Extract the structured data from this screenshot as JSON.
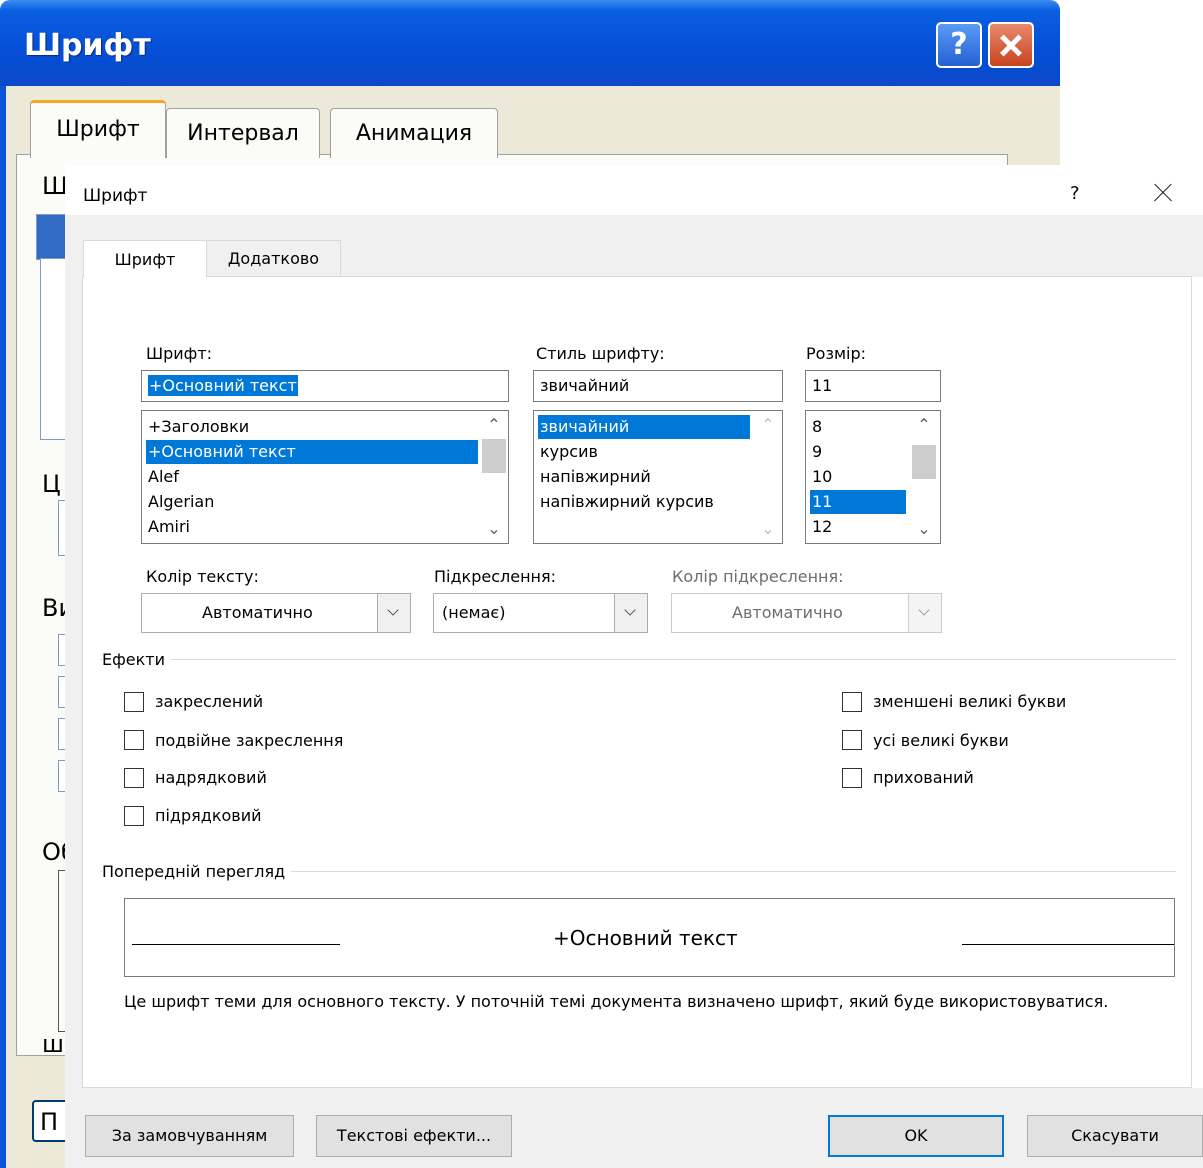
{
  "back_dialog": {
    "title": "Шрифт",
    "help_label": "?",
    "tabs": [
      "Шрифт",
      "Интервал",
      "Анимация"
    ],
    "partial_labels": [
      "Ш",
      "Ц",
      "Ви",
      "Об",
      "ш",
      "П"
    ]
  },
  "dialog": {
    "title": "Шрифт",
    "help_label": "?",
    "tabs": [
      {
        "label": "Шрифт",
        "active": true
      },
      {
        "label": "Додатково",
        "active": false
      }
    ],
    "font": {
      "label": "Шрифт:",
      "value": "+Основний текст",
      "items": [
        "+Заголовки",
        "+Основний текст",
        "Alef",
        "Algerian",
        "Amiri"
      ],
      "selected_index": 1
    },
    "style": {
      "label": "Стиль шрифту:",
      "value": "звичайний",
      "items": [
        "звичайний",
        "курсив",
        "напівжирний",
        "напівжирний курсив"
      ],
      "selected_index": 0
    },
    "size": {
      "label": "Розмір:",
      "value": "11",
      "items": [
        "8",
        "9",
        "10",
        "11",
        "12"
      ],
      "selected_index": 3
    },
    "text_color": {
      "label": "Колір тексту:",
      "value": "Автоматично"
    },
    "underline": {
      "label": "Підкреслення:",
      "value": "(немає)"
    },
    "underline_color": {
      "label": "Колір підкреслення:",
      "value": "Автоматично",
      "disabled": true
    },
    "effects": {
      "title": "Ефекти",
      "left": [
        {
          "label": "закреслений",
          "checked": false
        },
        {
          "label": "подвійне закреслення",
          "checked": false
        },
        {
          "label": "надрядковий",
          "checked": false
        },
        {
          "label": "підрядковий",
          "checked": false
        }
      ],
      "right": [
        {
          "label": "зменшені великі букви",
          "checked": false
        },
        {
          "label": "усі великі букви",
          "checked": false
        },
        {
          "label": "прихований",
          "checked": false
        }
      ]
    },
    "preview": {
      "title": "Попередній перегляд",
      "sample": "+Основний текст",
      "description": "Це шрифт теми для основного тексту. У поточній темі документа визначено шрифт, який буде використовуватися."
    },
    "buttons": {
      "default": "За замовчуванням",
      "text_effects": "Текстові ефекти...",
      "ok": "OK",
      "cancel": "Скасувати"
    }
  }
}
